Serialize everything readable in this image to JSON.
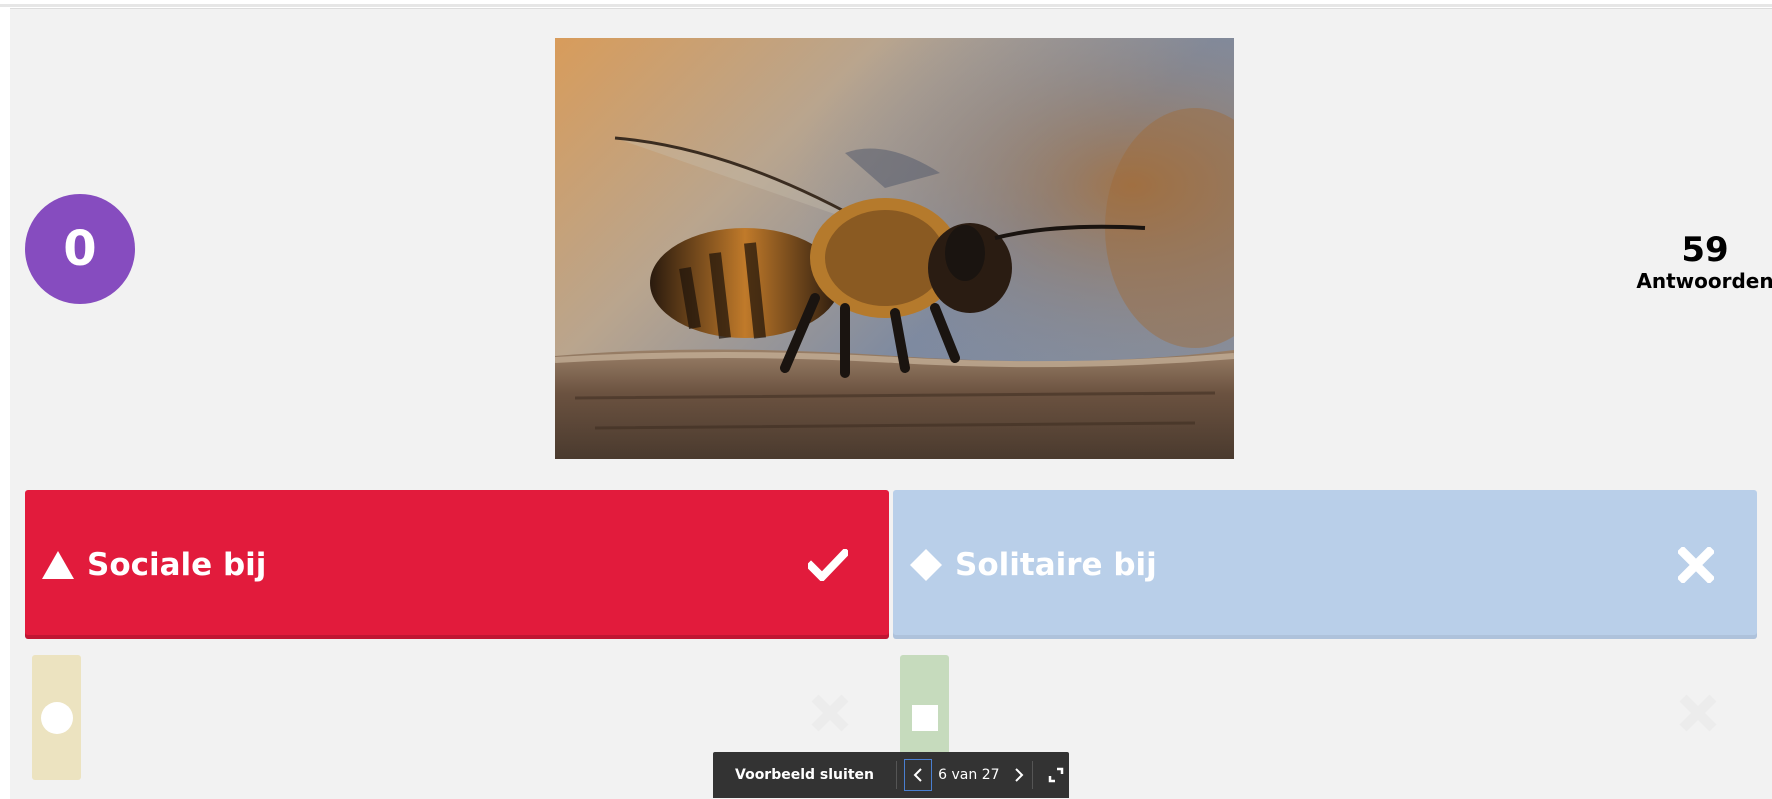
{
  "timer": {
    "value": "0"
  },
  "answers": {
    "count": "59",
    "label": "Antwoorden"
  },
  "question_image": {
    "subject": "bee-photo"
  },
  "options": [
    {
      "label": "Sociale bij",
      "shape": "triangle-icon",
      "color": "#e21b3c",
      "correct": true
    },
    {
      "label": "Solitaire bij",
      "shape": "diamond-icon",
      "color": "#b9cfe9",
      "correct": false
    }
  ],
  "faded_options": [
    {
      "shape": "circle-icon",
      "color": "#ece3c0"
    },
    {
      "shape": "square-icon",
      "color": "#c6dbbd"
    }
  ],
  "preview_bar": {
    "close_label": "Voorbeeld sluiten",
    "page_indicator": "6 van 27"
  },
  "colors": {
    "timer": "#864cbf",
    "bar": "#333333",
    "background": "#f2f2f2"
  }
}
